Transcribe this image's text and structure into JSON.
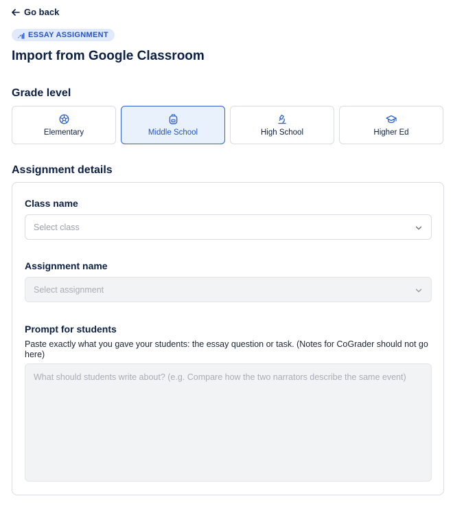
{
  "nav": {
    "back_label": "Go back"
  },
  "badge": {
    "label": "ESSAY ASSIGNMENT",
    "icon": "essay-icon"
  },
  "page": {
    "title": "Import from Google Classroom"
  },
  "grade_level": {
    "title": "Grade level",
    "selected": "Middle School",
    "options": [
      {
        "label": "Elementary",
        "icon": "elementary-icon"
      },
      {
        "label": "Middle School",
        "icon": "backpack-icon"
      },
      {
        "label": "High School",
        "icon": "microscope-icon"
      },
      {
        "label": "Higher Ed",
        "icon": "graduation-cap-icon"
      }
    ]
  },
  "details": {
    "title": "Assignment details",
    "class_name": {
      "label": "Class name",
      "placeholder": "Select class"
    },
    "assignment_name": {
      "label": "Assignment name",
      "placeholder": "Select assignment",
      "disabled": true
    },
    "prompt": {
      "label": "Prompt for students",
      "helper": "Paste exactly what you gave your students: the essay question or task. (Notes for CoGrader should not go here)",
      "placeholder": "What should students write about? (e.g. Compare how the two narrators describe the same event)"
    }
  },
  "colors": {
    "primary": "#2d63d6",
    "selected_bg": "#e9f1fd",
    "badge_bg": "#e1eafc",
    "heading": "#0b1f44"
  }
}
